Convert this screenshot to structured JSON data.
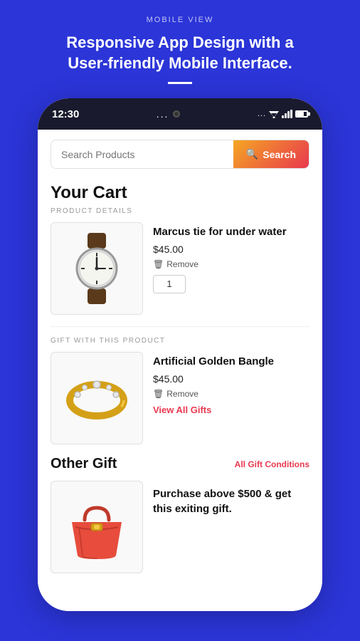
{
  "header": {
    "label": "MOBILE VIEW",
    "title": "Responsive App Design with a User-friendly Mobile Interface.",
    "divider": true
  },
  "statusBar": {
    "time": "12:30",
    "dots": "...",
    "moreIcons": "...",
    "battery": "70"
  },
  "search": {
    "placeholder": "Search Products",
    "button_label": "Search"
  },
  "cart": {
    "title": "Your Cart",
    "section_label": "PRODUCT DETAILS",
    "product": {
      "name": "Marcus tie for under water",
      "price": "$45.00",
      "remove_label": "Remove",
      "quantity": "1"
    }
  },
  "gift_section": {
    "label": "GIFT WITH THIS PRODUCT",
    "product": {
      "name": "Artificial Golden Bangle",
      "price": "$45.00",
      "remove_label": "Remove",
      "view_all_label": "View All Gifts"
    }
  },
  "other_gift": {
    "title": "Other Gift",
    "conditions_label": "All Gift Conditions",
    "description": "Purchase above $500 & get this exiting gift."
  }
}
